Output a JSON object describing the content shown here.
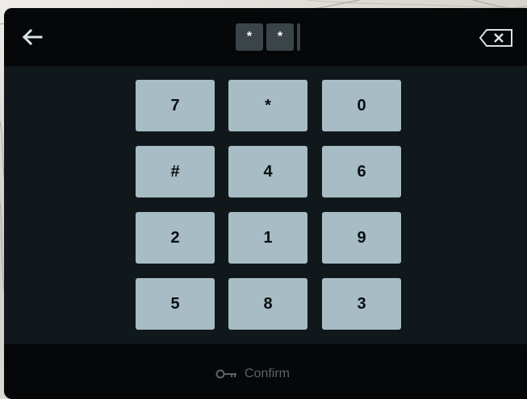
{
  "header": {
    "back_icon": "arrow-left-icon",
    "entered_mask": [
      "*",
      "*"
    ],
    "backspace_icon": "backspace-icon"
  },
  "keypad": {
    "keys": [
      "7",
      "*",
      "0",
      "#",
      "4",
      "6",
      "2",
      "1",
      "9",
      "5",
      "8",
      "3"
    ]
  },
  "footer": {
    "confirm_icon": "key-icon",
    "confirm_label": "Confirm"
  },
  "colors": {
    "panel_bg": "#050708",
    "keypad_bg": "#11181c",
    "key_bg": "#a7bcc4",
    "mask_bg": "#3b4449",
    "confirm_disabled": "#5a6469"
  }
}
